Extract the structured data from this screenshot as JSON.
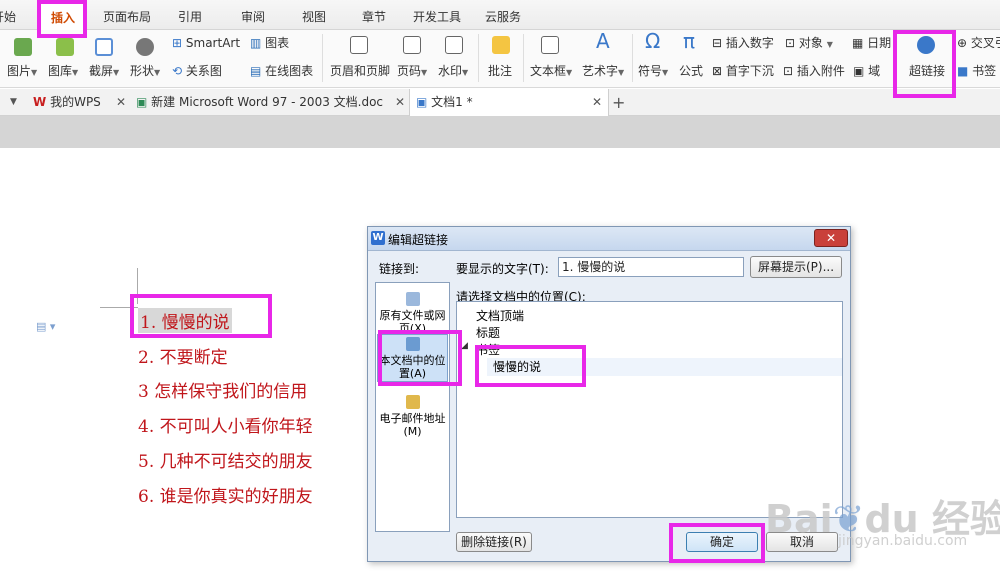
{
  "menu_tabs": [
    "开始",
    "插入",
    "页面布局",
    "引用",
    "审阅",
    "视图",
    "章节",
    "开发工具",
    "云服务"
  ],
  "ribbon": {
    "top_labels": [
      "SmartArt",
      "图表",
      "交叉引"
    ],
    "bottom_labels": [
      "图片",
      "图库",
      "截屏",
      "形状",
      "关系图",
      "在线图表",
      "页眉和页脚",
      "页码",
      "水印",
      "批注",
      "文本框",
      "艺术字",
      "符号",
      "公式",
      "首字下沉",
      "插入附件",
      "域",
      "超链接",
      "书签"
    ],
    "right_top_labels": [
      "插入数字",
      "对象",
      "日期"
    ]
  },
  "doc_tabs": [
    "我的WPS",
    "新建 Microsoft Word 97 - 2003 文档.doc",
    "文档1 *"
  ],
  "document_list": [
    "1.  慢慢的说",
    "2.  不要断定",
    "3  怎样保守我们的信用",
    "4.  不可叫人小看你年轻",
    "5.  几种不可结交的朋友",
    "6.  谁是你真实的好朋友"
  ],
  "dialog": {
    "title": "编辑超链接",
    "link_to_label": "链接到:",
    "display_text_label": "要显示的文字(T):",
    "display_text_value": "1. 慢慢的说",
    "screen_tip_button": "屏幕提示(P)...",
    "location_label": "请选择文档中的位置(C):",
    "left_panel": [
      "原有文件或网页(X)",
      "本文档中的位置(A)",
      "电子邮件地址(M)"
    ],
    "tree": [
      "文档顶端",
      "标题",
      "书签",
      "慢慢的说"
    ],
    "remove_link_button": "删除链接(R)",
    "ok_button": "确定",
    "cancel_button": "取消"
  },
  "watermark": {
    "brand": "Bai",
    "brand2": "du",
    "cn": "经验",
    "url": "jingyan.baidu.com"
  },
  "colors": {
    "highlight": "#e827e8",
    "list_red": "#c0161b",
    "active_tab": "#d04a02"
  }
}
